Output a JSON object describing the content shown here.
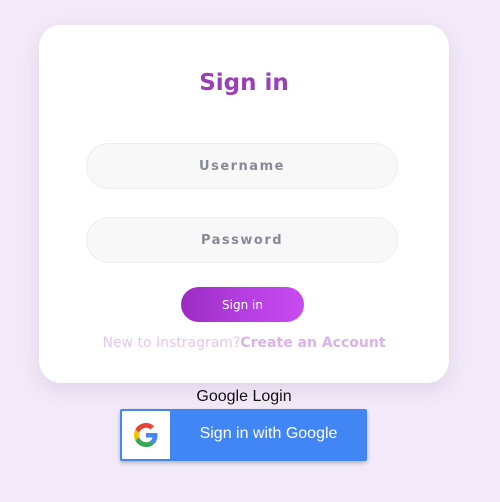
{
  "login_card": {
    "title": "Sign in",
    "username": {
      "placeholder": "Username",
      "value": ""
    },
    "password": {
      "placeholder": "Password",
      "value": ""
    },
    "submit_label": "Sign in",
    "signup_prompt": "New to Instragram?",
    "signup_link": "Create an Account"
  },
  "google_section": {
    "heading": "Google Login",
    "button_label": "Sign in with Google",
    "icon": "google-g-icon"
  },
  "colors": {
    "page_background": "#f2eaf8",
    "accent_purple": "#9a3fb5",
    "google_blue": "#4285f4"
  }
}
